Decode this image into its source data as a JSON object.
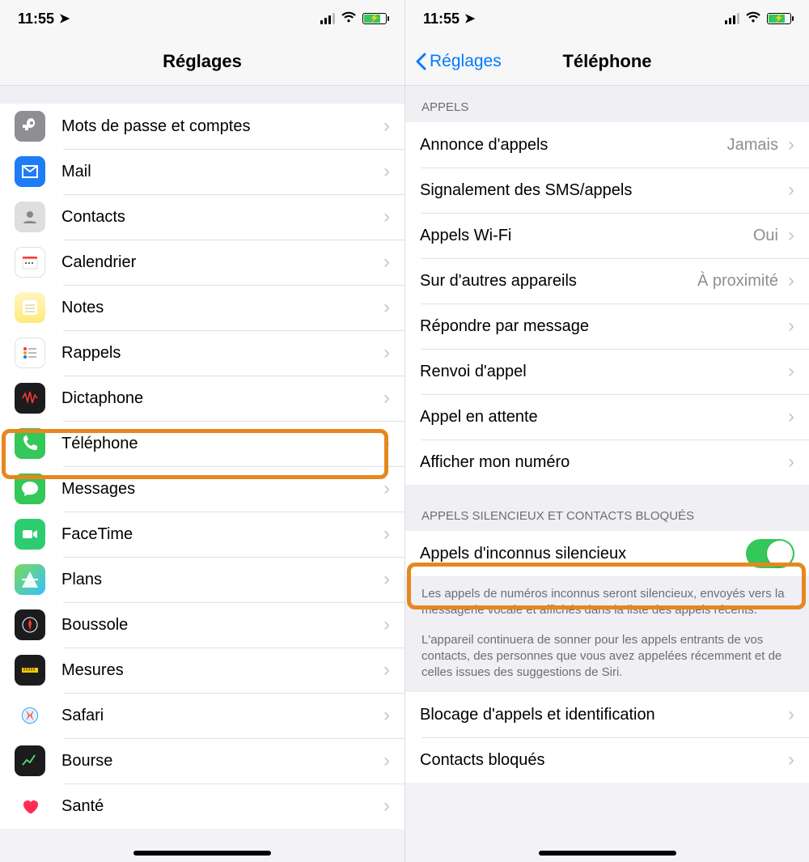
{
  "status": {
    "time": "11:55",
    "location_icon": "location-icon"
  },
  "left": {
    "title": "Réglages",
    "items": [
      {
        "key": "passwords",
        "label": "Mots de passe et comptes",
        "icon": "key-icon",
        "bg": "bg-gray"
      },
      {
        "key": "mail",
        "label": "Mail",
        "icon": "mail-icon",
        "bg": "bg-blue"
      },
      {
        "key": "contacts",
        "label": "Contacts",
        "icon": "contacts-icon",
        "bg": "bg-lightgray"
      },
      {
        "key": "calendar",
        "label": "Calendrier",
        "icon": "calendar-icon",
        "bg": "bg-white-bordered"
      },
      {
        "key": "notes",
        "label": "Notes",
        "icon": "notes-icon",
        "bg": "bg-yellow"
      },
      {
        "key": "reminders",
        "label": "Rappels",
        "icon": "reminders-icon",
        "bg": "bg-white-bordered"
      },
      {
        "key": "voicerec",
        "label": "Dictaphone",
        "icon": "voice-icon",
        "bg": "bg-black"
      },
      {
        "key": "phone",
        "label": "Téléphone",
        "icon": "phone-icon",
        "bg": "bg-green"
      },
      {
        "key": "messages",
        "label": "Messages",
        "icon": "messages-icon",
        "bg": "bg-green"
      },
      {
        "key": "facetime",
        "label": "FaceTime",
        "icon": "facetime-icon",
        "bg": "bg-darkgreen"
      },
      {
        "key": "maps",
        "label": "Plans",
        "icon": "maps-icon",
        "bg": "bg-maps"
      },
      {
        "key": "compass",
        "label": "Boussole",
        "icon": "compass-icon",
        "bg": "bg-black"
      },
      {
        "key": "measures",
        "label": "Mesures",
        "icon": "measure-icon",
        "bg": "bg-black"
      },
      {
        "key": "safari",
        "label": "Safari",
        "icon": "safari-icon",
        "bg": "bg-safari"
      },
      {
        "key": "stocks",
        "label": "Bourse",
        "icon": "stocks-icon",
        "bg": "bg-black"
      },
      {
        "key": "health",
        "label": "Santé",
        "icon": "health-icon",
        "bg": "bg-health"
      }
    ]
  },
  "right": {
    "back": "Réglages",
    "title": "Téléphone",
    "section1_header": "APPELS",
    "section1": [
      {
        "key": "announce",
        "label": "Annonce d'appels",
        "value": "Jamais"
      },
      {
        "key": "report",
        "label": "Signalement des SMS/appels",
        "value": ""
      },
      {
        "key": "wifi",
        "label": "Appels Wi-Fi",
        "value": "Oui"
      },
      {
        "key": "otherdev",
        "label": "Sur d'autres appareils",
        "value": "À proximité"
      },
      {
        "key": "respondmsg",
        "label": "Répondre par message",
        "value": ""
      },
      {
        "key": "forward",
        "label": "Renvoi d'appel",
        "value": ""
      },
      {
        "key": "waiting",
        "label": "Appel en attente",
        "value": ""
      },
      {
        "key": "showid",
        "label": "Afficher mon numéro",
        "value": ""
      }
    ],
    "section2_header": "APPELS SILENCIEUX ET CONTACTS BLOQUÉS",
    "silence_row": {
      "label": "Appels d'inconnus silencieux",
      "on": true
    },
    "footer1": "Les appels de numéros inconnus seront silencieux, envoyés vers la messagerie vocale et affichés dans la liste des appels récents.",
    "footer2": "L'appareil continuera de sonner pour les appels entrants de vos contacts, des personnes que vous avez appelées récemment et de celles issues des suggestions de Siri.",
    "section3": [
      {
        "key": "blockid",
        "label": "Blocage d'appels et identification"
      },
      {
        "key": "blocked",
        "label": "Contacts bloqués"
      }
    ]
  }
}
